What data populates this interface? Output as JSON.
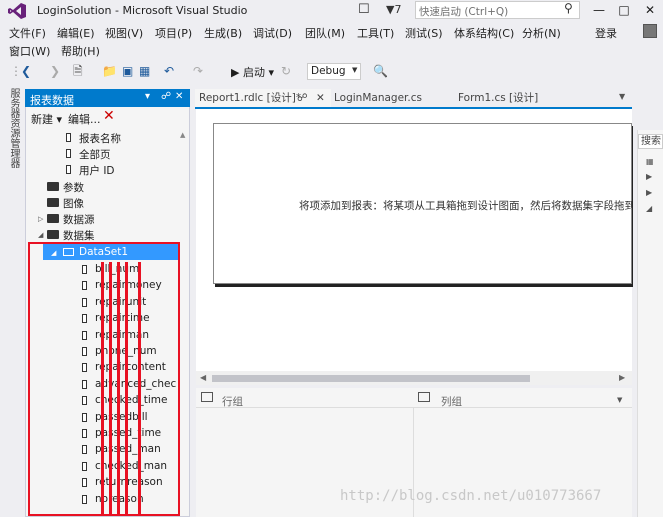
{
  "window": {
    "title": "LoginSolution - Microsoft Visual Studio",
    "notification_count": "▼7",
    "quick_launch_placeholder": "快速启动 (Ctrl+Q)",
    "minimize": "—",
    "restore": "□",
    "close": "✕"
  },
  "menu": {
    "row1": [
      "文件(F)",
      "编辑(E)",
      "视图(V)",
      "项目(P)",
      "生成(B)",
      "调试(D)",
      "团队(M)",
      "工具(T)",
      "测试(S)",
      "体系结构(C)",
      "分析(N)"
    ],
    "row2": [
      "窗口(W)",
      "帮助(H)"
    ],
    "login": "登录"
  },
  "toolbar": {
    "start_label": "▶ 启动 ▾",
    "config_value": "Debug"
  },
  "left_vertical_tab": "服务器资源管理器",
  "report_data_panel": {
    "title": "报表数据",
    "pin": "▾ ❙ ✕",
    "new_label": "新建 ▾",
    "edit_label": "编辑...",
    "tree": [
      {
        "label": "报表名称",
        "kind": "field"
      },
      {
        "label": "全部页",
        "kind": "field"
      },
      {
        "label": "用户 ID",
        "kind": "field"
      },
      {
        "label": "参数",
        "kind": "folder"
      },
      {
        "label": "图像",
        "kind": "folder"
      },
      {
        "label": "数据源",
        "kind": "folder",
        "collapsed": true
      },
      {
        "label": "数据集",
        "kind": "folder",
        "expanded": true
      }
    ],
    "dataset": "DataSet1",
    "fields": [
      "bill_num",
      "repairmoney",
      "repairunit",
      "repairtime",
      "repairman",
      "phone_num",
      "repaircontent",
      "advanced_checker",
      "checked_time",
      "passedbill",
      "passed_time",
      "passed_man",
      "checked_man",
      "returnreason",
      "noreason"
    ]
  },
  "tabs": {
    "tab1": "Report1.rdlc [设计]*",
    "tab2": "LoginManager.cs",
    "tab3": "Form1.cs [设计]"
  },
  "design": {
    "hint": "将项添加到报表：将某项从工具箱拖到设计图面，然后将数据集字段拖到该项"
  },
  "groups": {
    "row_groups": "行组",
    "column_groups": "列组"
  },
  "right_strip": {
    "search": "搜索"
  },
  "watermark": "http://blog.csdn.net/u010773667",
  "colors": {
    "accent": "#007acc",
    "selection": "#3399ff",
    "highlight_box": "#e81123"
  }
}
